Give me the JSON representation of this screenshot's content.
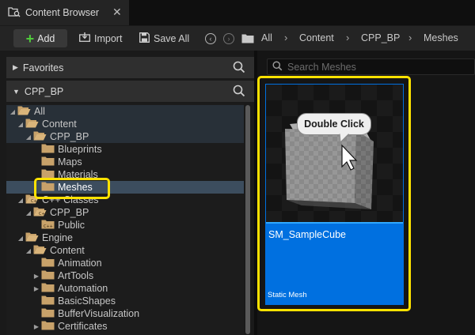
{
  "tab": {
    "title": "Content Browser",
    "close": "✕"
  },
  "toolbar": {
    "add_label": "Add",
    "import_label": "Import",
    "save_all_label": "Save All",
    "breadcrumb": [
      "All",
      "Content",
      "CPP_BP",
      "Meshes"
    ]
  },
  "sections": {
    "favorites": "Favorites",
    "project": "CPP_BP"
  },
  "tree": [
    {
      "label": "All"
    },
    {
      "label": "Content"
    },
    {
      "label": "CPP_BP"
    },
    {
      "label": "Blueprints"
    },
    {
      "label": "Maps"
    },
    {
      "label": "Materials"
    },
    {
      "label": "Meshes",
      "selected": true
    },
    {
      "label": "C++ Classes"
    },
    {
      "label": "CPP_BP"
    },
    {
      "label": "Public"
    },
    {
      "label": "Engine"
    },
    {
      "label": "Content"
    },
    {
      "label": "Animation"
    },
    {
      "label": "ArtTools"
    },
    {
      "label": "Automation"
    },
    {
      "label": "BasicShapes"
    },
    {
      "label": "BufferVisualization"
    },
    {
      "label": "Certificates"
    }
  ],
  "search": {
    "placeholder": "Search Meshes"
  },
  "asset": {
    "name": "SM_SampleCube",
    "type": "Static Mesh"
  },
  "callout": {
    "text": "Double Click"
  },
  "colors": {
    "highlight": "#ffe200",
    "selection": "#0070e0",
    "add_plus": "#4fcc3b",
    "folder": "#c8a26a"
  }
}
